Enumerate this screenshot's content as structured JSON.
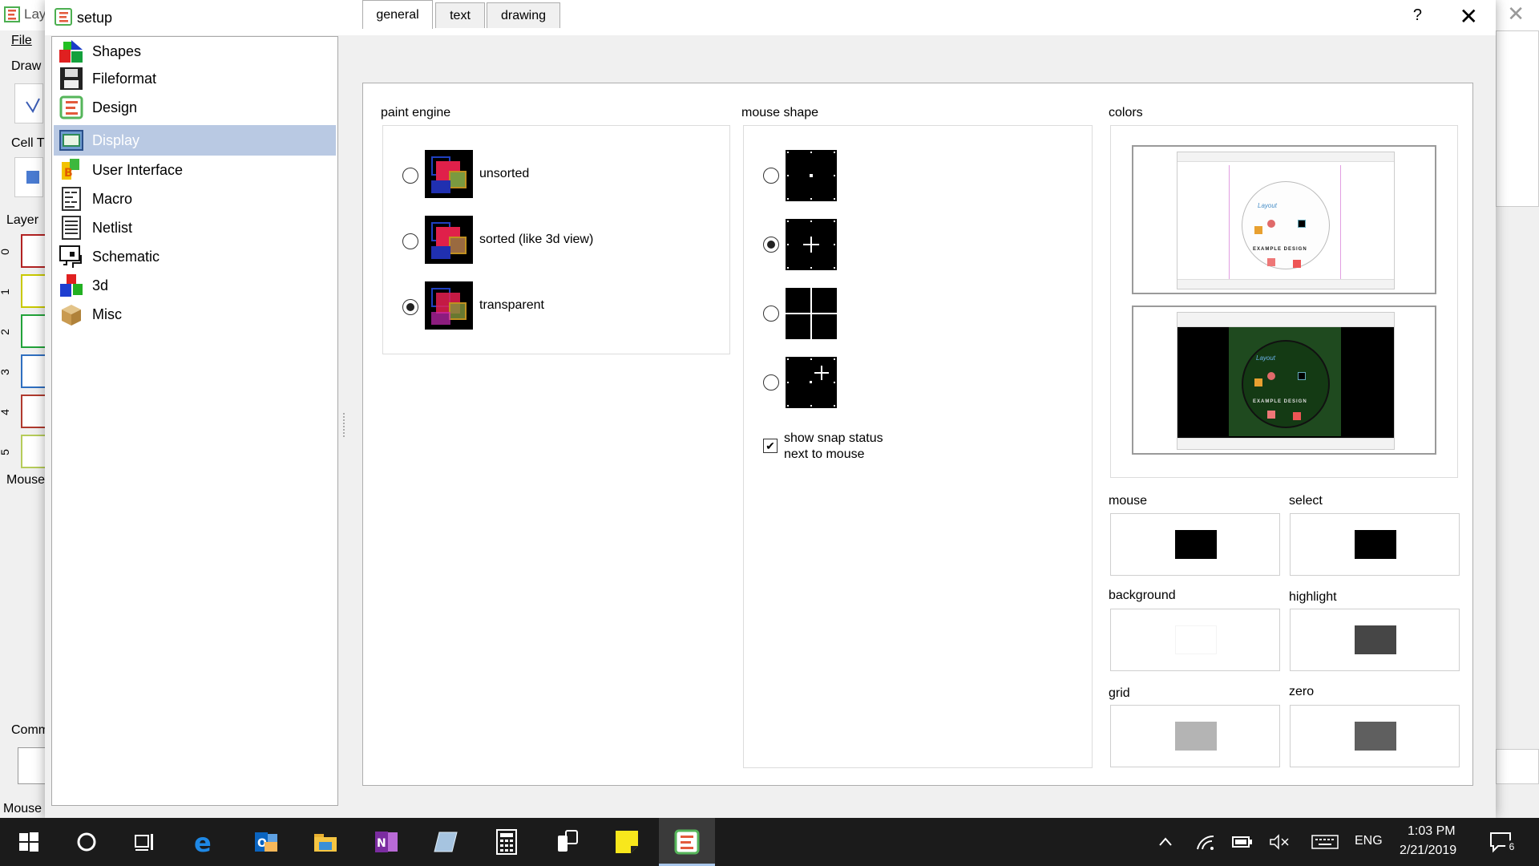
{
  "background_app": {
    "title": "Lay",
    "menu_file": "File",
    "toolbar_draw": "Draw",
    "cell_label": "Cell T",
    "layer_label": "Layer",
    "layer_numbers": [
      "0",
      "1",
      "2",
      "3",
      "4",
      "5"
    ],
    "mouse_label": "Mouse",
    "command_label": "Comm",
    "status_mouse": "Mouse"
  },
  "dialog": {
    "title": "setup",
    "help_symbol": "?",
    "close_symbol": "✕"
  },
  "nav": {
    "items": [
      {
        "label": "Shapes",
        "icon": "shapes-icon"
      },
      {
        "label": "Fileformat",
        "icon": "floppy-disk-icon"
      },
      {
        "label": "Design",
        "icon": "layouteditor-logo-icon"
      },
      {
        "label": "Display",
        "icon": "display-icon",
        "selected": true
      },
      {
        "label": "User Interface",
        "icon": "user-interface-icon"
      },
      {
        "label": "Macro",
        "icon": "macro-icon"
      },
      {
        "label": "Netlist",
        "icon": "netlist-icon"
      },
      {
        "label": "Schematic",
        "icon": "schematic-icon"
      },
      {
        "label": "3d",
        "icon": "3d-cubes-icon"
      },
      {
        "label": "Misc",
        "icon": "box-icon"
      }
    ]
  },
  "tabs": [
    {
      "label": "general",
      "active": true
    },
    {
      "label": "text",
      "active": false
    },
    {
      "label": "drawing",
      "active": false
    }
  ],
  "paint_engine": {
    "title": "paint engine",
    "options": [
      {
        "label": "unsorted",
        "checked": false
      },
      {
        "label": "sorted (like 3d view)",
        "checked": false
      },
      {
        "label": "transparent",
        "checked": true
      }
    ]
  },
  "mouse_shape": {
    "title": "mouse shape",
    "options": [
      {
        "shape": "dot-cursor-icon",
        "checked": false
      },
      {
        "shape": "small-cross-cursor-icon",
        "checked": true
      },
      {
        "shape": "full-cross-cursor-icon",
        "checked": false
      },
      {
        "shape": "offset-cross-cursor-icon",
        "checked": false
      }
    ],
    "snap_status_line1": "show snap status",
    "snap_status_line2": "next to mouse",
    "snap_status_checked": true
  },
  "colors": {
    "title": "colors",
    "preview_light_text": "EXAMPLE DESIGN",
    "preview_dark_text": "EXAMPLE DESIGN",
    "entries": [
      {
        "label": "mouse",
        "color": "#000000"
      },
      {
        "label": "select",
        "color": "#000000"
      },
      {
        "label": "background",
        "color": "#ffffff"
      },
      {
        "label": "highlight",
        "color": "#464646"
      },
      {
        "label": "grid",
        "color": "#b4b4b4"
      },
      {
        "label": "zero",
        "color": "#5f5f5f"
      }
    ]
  },
  "taskbar": {
    "time": "1:03 PM",
    "date": "2/21/2019",
    "language": "ENG",
    "notifications": "6"
  }
}
